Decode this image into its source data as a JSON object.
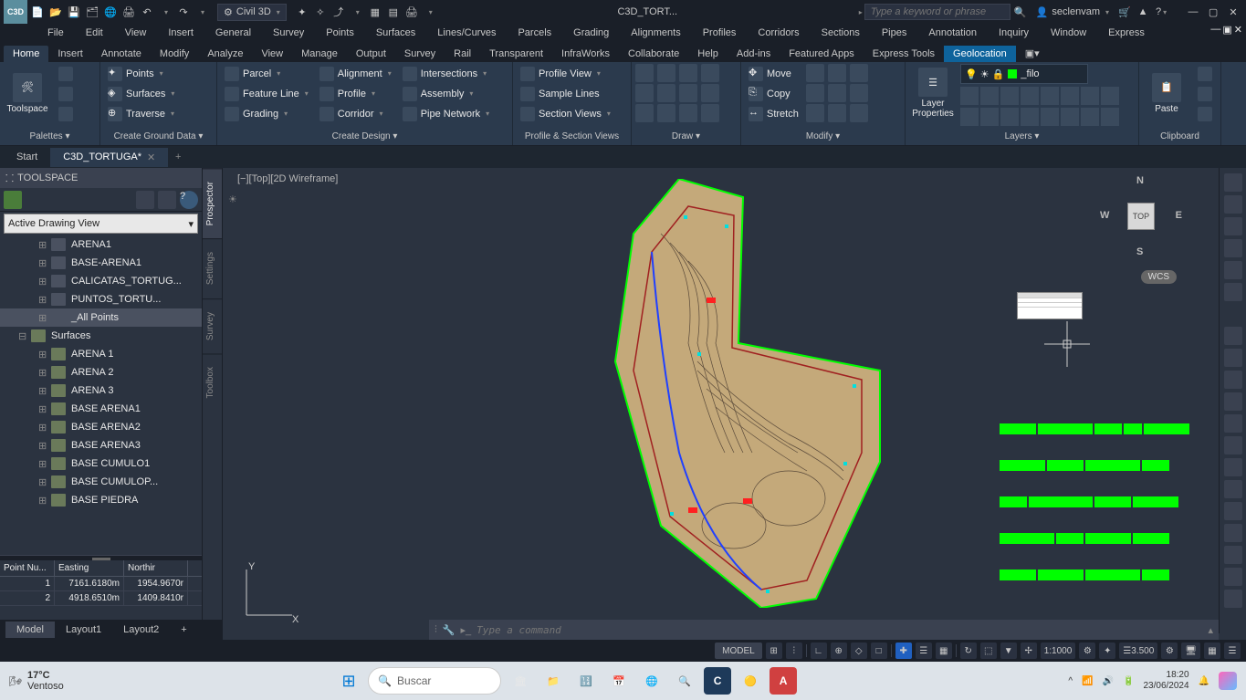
{
  "titlebar": {
    "app_icon_label": "C3D",
    "workspace": "Civil 3D",
    "document": "C3D_TORT...",
    "search_placeholder": "Type a keyword or phrase",
    "username": "seclenvam"
  },
  "menubar": [
    "File",
    "Edit",
    "View",
    "Insert",
    "General",
    "Survey",
    "Points",
    "Surfaces",
    "Lines/Curves",
    "Parcels",
    "Grading",
    "Alignments",
    "Profiles",
    "Corridors",
    "Sections",
    "Pipes",
    "Annotation",
    "Inquiry",
    "Window",
    "Express"
  ],
  "ribbon_tabs": [
    "Home",
    "Insert",
    "Annotate",
    "Modify",
    "Analyze",
    "View",
    "Manage",
    "Output",
    "Survey",
    "Rail",
    "Transparent",
    "InfraWorks",
    "Collaborate",
    "Help",
    "Add-ins",
    "Featured Apps",
    "Express Tools",
    "Geolocation"
  ],
  "ribbon_active": 0,
  "ribbon_highlight": 17,
  "ribbon": {
    "palettes": {
      "title": "Palettes ▾",
      "main": "Toolspace"
    },
    "ground": {
      "title": "Create Ground Data ▾",
      "items": [
        "Points",
        "Surfaces",
        "Traverse"
      ]
    },
    "design": {
      "title": "Create Design ▾",
      "col1": [
        "Parcel",
        "Feature Line",
        "Grading"
      ],
      "col2": [
        "Alignment",
        "Profile",
        "Corridor"
      ],
      "col3": [
        "Intersections",
        "Assembly",
        "Pipe Network"
      ]
    },
    "profile": {
      "title": "Profile & Section Views",
      "items": [
        "Profile View",
        "Sample Lines",
        "Section Views"
      ]
    },
    "draw": {
      "title": "Draw ▾"
    },
    "modify": {
      "title": "Modify ▾",
      "items": [
        "Move",
        "Copy",
        "Stretch"
      ]
    },
    "layers": {
      "title": "Layers ▾",
      "main": "Layer Properties",
      "current": "_filo"
    },
    "clipboard": {
      "title": "Clipboard",
      "main": "Paste"
    }
  },
  "doc_tabs": [
    {
      "label": "Start",
      "active": false
    },
    {
      "label": "C3D_TORTUGA*",
      "active": true
    }
  ],
  "toolspace": {
    "title": "TOOLSPACE",
    "view_select": "Active Drawing View",
    "tree_points": [
      "ARENA1",
      "BASE-ARENA1",
      "CALICATAS_TORTUG...",
      "PUNTOS_TORTU...",
      "_All Points"
    ],
    "tree_surfaces_label": "Surfaces",
    "tree_surfaces": [
      "ARENA 1",
      "ARENA 2",
      "ARENA 3",
      "BASE ARENA1",
      "BASE ARENA2",
      "BASE ARENA3",
      "BASE CUMULO1",
      "BASE CUMULOP...",
      "BASE PIEDRA"
    ],
    "selected": "_All Points",
    "point_table": {
      "headers": [
        "Point Nu...",
        "Easting",
        "Northir"
      ],
      "rows": [
        [
          "1",
          "7161.6180m",
          "1954.9670r"
        ],
        [
          "2",
          "4918.6510m",
          "1409.8410r"
        ]
      ]
    },
    "side_tabs": [
      "Prospector",
      "Settings",
      "Survey",
      "Toolbox"
    ]
  },
  "viewport": {
    "label": "[−][Top][2D Wireframe]",
    "cube": {
      "n": "N",
      "s": "S",
      "e": "E",
      "w": "W",
      "face": "TOP"
    },
    "wcs": "WCS",
    "ucs": {
      "y": "Y",
      "x": "X"
    }
  },
  "command": {
    "placeholder": "Type a command"
  },
  "layout_tabs": [
    "Model",
    "Layout1",
    "Layout2"
  ],
  "statusbar": {
    "model": "MODEL",
    "scale": "1:1000",
    "decimals": "3.500"
  },
  "taskbar": {
    "temp": "17°C",
    "cond": "Ventoso",
    "search": "Buscar",
    "time": "18:20",
    "date": "23/06/2024"
  }
}
